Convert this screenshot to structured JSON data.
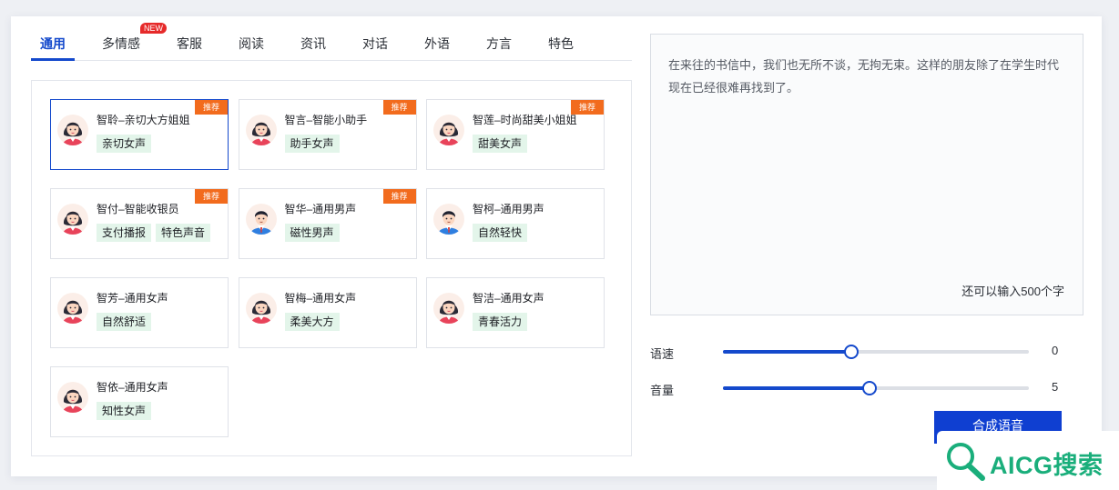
{
  "tabs": [
    {
      "label": "通用",
      "active": true
    },
    {
      "label": "多情感",
      "badge": "NEW"
    },
    {
      "label": "客服"
    },
    {
      "label": "阅读"
    },
    {
      "label": "资讯"
    },
    {
      "label": "对话"
    },
    {
      "label": "外语"
    },
    {
      "label": "方言"
    },
    {
      "label": "特色"
    }
  ],
  "voices": [
    {
      "name": "智聆–亲切大方姐姐",
      "gender": "female",
      "tags": [
        "亲切女声"
      ],
      "recommended": "推荐",
      "selected": true
    },
    {
      "name": "智言–智能小助手",
      "gender": "female",
      "tags": [
        "助手女声"
      ],
      "recommended": "推荐"
    },
    {
      "name": "智莲–时尚甜美小姐姐",
      "gender": "female",
      "tags": [
        "甜美女声"
      ],
      "recommended": "推荐"
    },
    {
      "name": "智付–智能收银员",
      "gender": "female",
      "tags": [
        "支付播报",
        "特色声音"
      ],
      "recommended": "推荐"
    },
    {
      "name": "智华–通用男声",
      "gender": "male",
      "tags": [
        "磁性男声"
      ],
      "recommended": "推荐"
    },
    {
      "name": "智柯–通用男声",
      "gender": "male",
      "tags": [
        "自然轻快"
      ]
    },
    {
      "name": "智芳–通用女声",
      "gender": "female",
      "tags": [
        "自然舒适"
      ]
    },
    {
      "name": "智梅–通用女声",
      "gender": "female",
      "tags": [
        "柔美大方"
      ]
    },
    {
      "name": "智洁–通用女声",
      "gender": "female",
      "tags": [
        "青春活力"
      ]
    },
    {
      "name": "智依–通用女声",
      "gender": "female",
      "tags": [
        "知性女声"
      ]
    }
  ],
  "editor": {
    "text": "在来往的书信中，我们也无所不谈，无拘无束。这样的朋友除了在学生时代现在已经很难再找到了。",
    "remaining": "还可以输入500个字"
  },
  "speed": {
    "label": "语速",
    "value": "0",
    "level": 0.42
  },
  "volume": {
    "label": "音量",
    "value": "5",
    "level": 0.48
  },
  "synthesize_label": "合成语音",
  "watermark": {
    "text": "AICG搜索"
  },
  "colors": {
    "accent": "#1449cc",
    "recommend": "#f26b1d",
    "tag_bg": "#e3f5ea",
    "new_badge": "#e62a2a",
    "watermark": "#1aae7b"
  }
}
